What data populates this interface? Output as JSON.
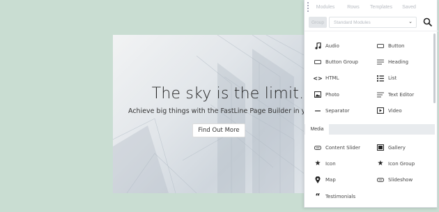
{
  "hero": {
    "title": "The sky is the limit.",
    "subtitle": "Achieve big things with the FastLine Page Builder in your arsenal",
    "button": "Find Out More"
  },
  "panel": {
    "tabs": [
      "Modules",
      "Rows",
      "Templates",
      "Saved"
    ],
    "group_label": "Group",
    "module_select": "Standard Modules",
    "section_media": "Media",
    "basic_modules": [
      {
        "label": "Audio",
        "icon": "music-note-icon"
      },
      {
        "label": "Button",
        "icon": "button-icon"
      },
      {
        "label": "Button Group",
        "icon": "button-group-icon"
      },
      {
        "label": "Heading",
        "icon": "heading-icon"
      },
      {
        "label": "HTML",
        "icon": "code-icon"
      },
      {
        "label": "List",
        "icon": "list-icon"
      },
      {
        "label": "Photo",
        "icon": "photo-icon"
      },
      {
        "label": "Text Editor",
        "icon": "text-editor-icon"
      },
      {
        "label": "Separator",
        "icon": "separator-icon"
      },
      {
        "label": "Video",
        "icon": "video-icon"
      }
    ],
    "media_modules": [
      {
        "label": "Content Slider",
        "icon": "slider-icon"
      },
      {
        "label": "Gallery",
        "icon": "gallery-icon"
      },
      {
        "label": "Icon",
        "icon": "star-icon"
      },
      {
        "label": "Icon Group",
        "icon": "star-icon"
      },
      {
        "label": "Map",
        "icon": "map-pin-icon"
      },
      {
        "label": "Slideshow",
        "icon": "slideshow-icon"
      },
      {
        "label": "Testimonials",
        "icon": "quote-icon"
      }
    ]
  }
}
